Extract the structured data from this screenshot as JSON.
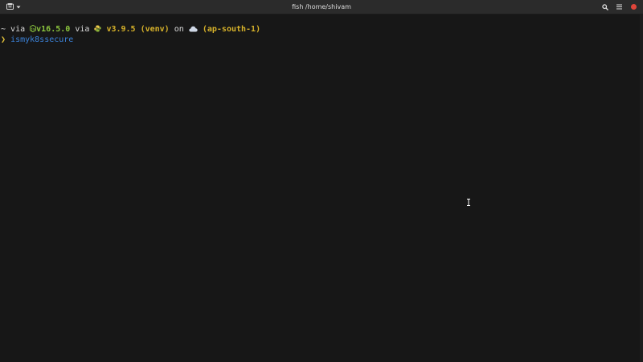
{
  "window": {
    "title": "fish /home/shivam",
    "icons": {
      "new_tab": "terminal-tab-icon",
      "menu_caret": "chevron-down-icon",
      "search": "search-icon",
      "hamburger": "menu-icon",
      "close": "close-icon"
    },
    "close_color": "#e0453a"
  },
  "terminal": {
    "prompt_line": {
      "cwd": "~",
      "via1": " via ",
      "node_icon": "nodejs-icon",
      "node_version": "v16.5.0",
      "via2": " via ",
      "python_icon": "python-icon",
      "python_version": "v3.9.5 (venv)",
      "on": " on ",
      "cloud_icon": "cloud-icon",
      "aws_region": "(ap-south-1)"
    },
    "input_line": {
      "prompt_symbol": "❯",
      "command": "ismyk8ssecure"
    }
  },
  "colors": {
    "background": "#171717",
    "node_green": "#8cc63e",
    "python_yellow": "#d7b22a",
    "command_blue": "#3b82d8",
    "prompt_yellow": "#e6c53b"
  }
}
